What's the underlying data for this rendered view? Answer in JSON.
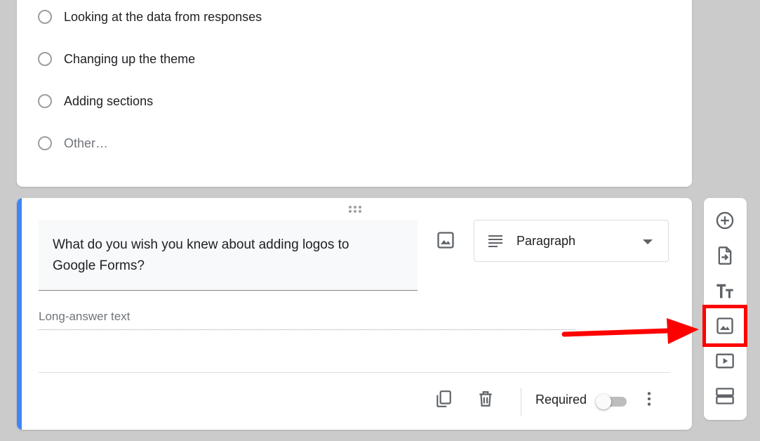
{
  "options": [
    {
      "label": "Looking at the data from responses",
      "muted": false
    },
    {
      "label": "Changing up the theme",
      "muted": false
    },
    {
      "label": "Adding sections",
      "muted": false
    },
    {
      "label": "Other…",
      "muted": true
    }
  ],
  "question": {
    "title": "What do you wish you knew about adding logos to Google Forms?",
    "type_label": "Paragraph",
    "answer_placeholder": "Long-answer text",
    "required_label": "Required",
    "required": false
  },
  "toolbar": {
    "tools": [
      "add-question-icon",
      "import-questions-icon",
      "add-title-icon",
      "add-image-icon",
      "add-video-icon",
      "add-section-icon"
    ],
    "highlighted_tool": "add-image-icon"
  },
  "colors": {
    "accent": "#4285f4",
    "highlight": "#ff0000",
    "background": "#cbcbcb"
  }
}
